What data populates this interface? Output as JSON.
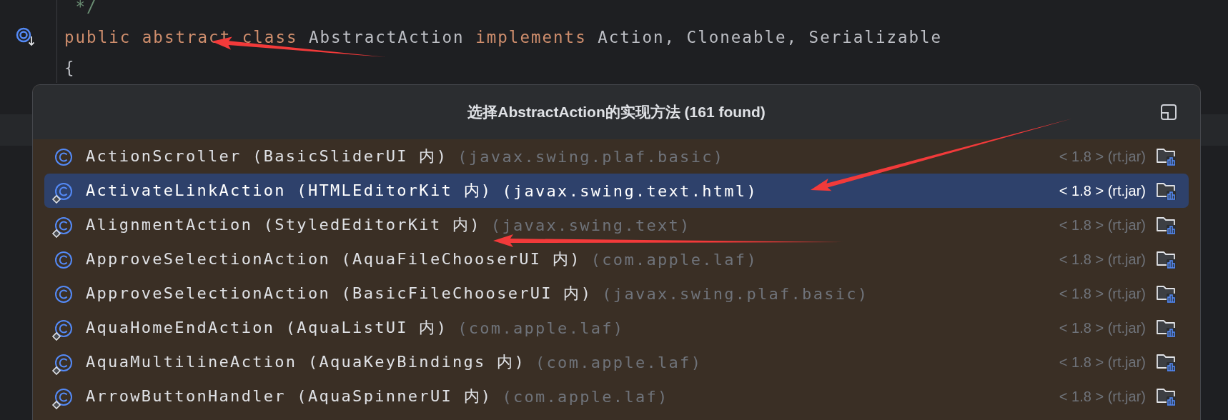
{
  "editor": {
    "lines": [
      {
        "gutter_icon": false,
        "tokens": [
          {
            "kind": "comment",
            "text": " */"
          }
        ]
      },
      {
        "gutter_icon": true,
        "tokens": [
          {
            "kind": "keyword",
            "text": "public abstract class "
          },
          {
            "kind": "plain",
            "text": "AbstractAction "
          },
          {
            "kind": "keyword",
            "text": "implements "
          },
          {
            "kind": "plain",
            "text": "Action, Cloneable, Serializable"
          }
        ]
      },
      {
        "gutter_icon": false,
        "tokens": [
          {
            "kind": "plain",
            "text": "{"
          }
        ]
      }
    ]
  },
  "popup": {
    "title": "选择AbstractAction的实现方法 (161 found)",
    "rows": [
      {
        "name": "ActionScroller (BasicSliderUI 内)",
        "package": "(javax.swing.plaf.basic)",
        "version": "< 1.8 > (rt.jar)",
        "diamond": false,
        "selected": false
      },
      {
        "name": "ActivateLinkAction (HTMLEditorKit 内)",
        "package": "(javax.swing.text.html)",
        "version": "< 1.8 > (rt.jar)",
        "diamond": true,
        "selected": true
      },
      {
        "name": "AlignmentAction (StyledEditorKit 内)",
        "package": "(javax.swing.text)",
        "version": "< 1.8 > (rt.jar)",
        "diamond": true,
        "selected": false
      },
      {
        "name": "ApproveSelectionAction (AquaFileChooserUI 内)",
        "package": "(com.apple.laf)",
        "version": "< 1.8 > (rt.jar)",
        "diamond": false,
        "selected": false
      },
      {
        "name": "ApproveSelectionAction (BasicFileChooserUI 内)",
        "package": "(javax.swing.plaf.basic)",
        "version": "< 1.8 > (rt.jar)",
        "diamond": false,
        "selected": false
      },
      {
        "name": "AquaHomeEndAction (AquaListUI 内)",
        "package": "(com.apple.laf)",
        "version": "< 1.8 > (rt.jar)",
        "diamond": true,
        "selected": false
      },
      {
        "name": "AquaMultilineAction (AquaKeyBindings 内)",
        "package": "(com.apple.laf)",
        "version": "< 1.8 > (rt.jar)",
        "diamond": true,
        "selected": false
      },
      {
        "name": "ArrowButtonHandler (AquaSpinnerUI 内)",
        "package": "(com.apple.laf)",
        "version": "< 1.8 > (rt.jar)",
        "diamond": true,
        "selected": false
      }
    ]
  }
}
